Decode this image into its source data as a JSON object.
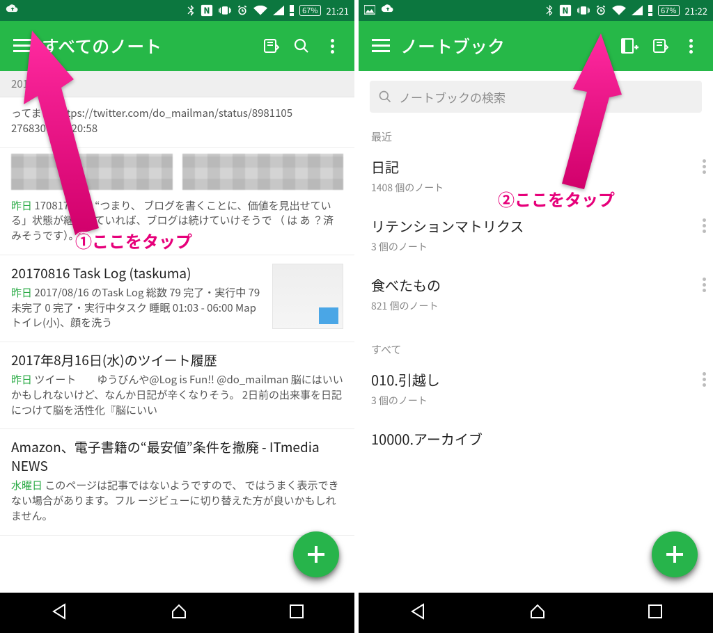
{
  "left": {
    "status": {
      "time": "21:21",
      "battery": "67%",
      "icons": [
        "cloud",
        "bt",
        "nfc",
        "vib",
        "alarm",
        "wifi",
        "signal",
        "warn"
      ]
    },
    "appbar": {
      "title": "すべてのノート"
    },
    "date_header": "2017    月",
    "notes": [
      {
        "title": "",
        "day": "",
        "body": "ってま   た https://twitter.com/do_mailman/status/8981105  2768306176 20:58"
      },
      {
        "title": "",
        "day": "昨日",
        "body": "170817-08 8 “つまり、 ブログを書くことに、価値を見出せている」状態が継続していれば、ブログは続けていけそうで （   は   あ  ？済みそうです）。"
      },
      {
        "title": "20170816 Task Log (taskuma)",
        "day": "昨日",
        "body": "2017/08/16 のTask Log 総数 79 完了・実行中 79 未完了 0 完了・実行中タスク 睡眠 01:03 - 06:00 Map トイレ(小)、顔を洗う"
      },
      {
        "title": "2017年8月16日(水)のツイート履歴",
        "day": "昨日",
        "body": "ツイート　　ゆうびんや@Log is Fun!! @do_mailman 脳にはいいかもしれないけど、なんか日記が辛くなりそう。 2日前の出来事を日記につけて脳を活性化『脳にいい"
      },
      {
        "title": "Amazon、電子書籍の“最安値”条件を撤廃 - ITmedia NEWS",
        "day": "水曜日",
        "body": "このページは記事ではないようですので、  ではうまく表示できない場合があります。フル  ージビューに切り替えた方が良いかもしれません。"
      }
    ],
    "annotation": "①ここをタップ"
  },
  "right": {
    "status": {
      "time": "21:22",
      "battery": "67%",
      "icons": [
        "img",
        "cloud",
        "bt",
        "nfc",
        "vib",
        "alarm",
        "wifi",
        "signal",
        "warn"
      ]
    },
    "appbar": {
      "title": "ノートブック"
    },
    "search_placeholder": "ノートブックの検索",
    "section_recent": "最近",
    "section_all": "すべて",
    "notebooks_recent": [
      {
        "name": "日記",
        "sub": "1408 個のノート"
      },
      {
        "name": "リテンションマトリクス",
        "sub": "3 個のノート"
      },
      {
        "name": "食べたもの",
        "sub": "821 個のノート"
      }
    ],
    "notebooks_all": [
      {
        "name": "010.引越し",
        "sub": "3 個のノート"
      },
      {
        "name": "10000.アーカイブ",
        "sub": ""
      }
    ],
    "annotation": "②ここをタップ"
  }
}
